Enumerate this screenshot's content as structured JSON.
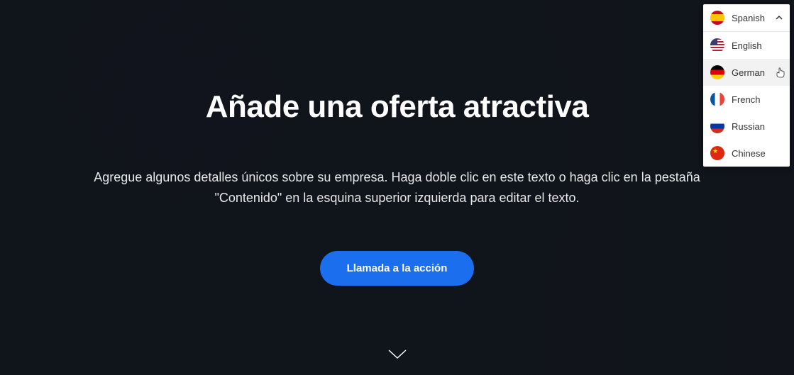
{
  "hero": {
    "title": "Añade una oferta atractiva",
    "description": "Agregue algunos detalles únicos sobre su empresa. Haga doble clic en este texto o haga clic en la pestaña \"Contenido\" en la esquina superior izquierda para editar el texto.",
    "cta_label": "Llamada a la acción"
  },
  "language_dropdown": {
    "selected": "Spanish",
    "hovered": "German",
    "options": [
      {
        "label": "Spanish",
        "flag": "spain"
      },
      {
        "label": "English",
        "flag": "usa"
      },
      {
        "label": "German",
        "flag": "germany"
      },
      {
        "label": "French",
        "flag": "france"
      },
      {
        "label": "Russian",
        "flag": "russia"
      },
      {
        "label": "Chinese",
        "flag": "china"
      }
    ]
  }
}
